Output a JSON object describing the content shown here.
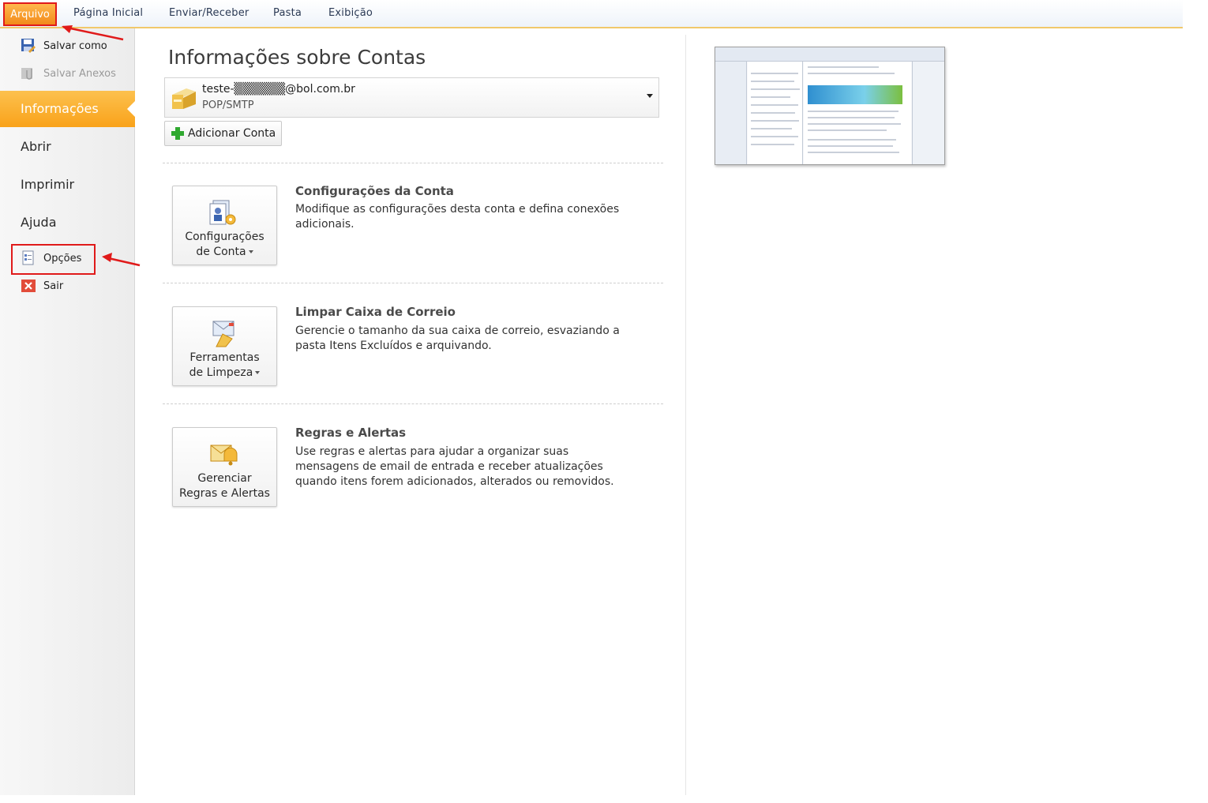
{
  "ribbon": {
    "file_tab": "Arquivo",
    "tabs": [
      "Página Inicial",
      "Enviar/Receber",
      "Pasta",
      "Exibição"
    ]
  },
  "nav": {
    "save_as": "Salvar como",
    "save_attachments": "Salvar Anexos",
    "tabs": [
      "Informações",
      "Abrir",
      "Imprimir",
      "Ajuda"
    ],
    "options": "Opções",
    "exit": "Sair"
  },
  "main": {
    "title": "Informações sobre Contas",
    "account": {
      "email": "teste-▒▒▒▒▒▒@bol.com.br",
      "type": "POP/SMTP"
    },
    "add_account": "Adicionar Conta",
    "sections": [
      {
        "button_line1": "Configurações",
        "button_line2": "de Conta",
        "title": "Configurações da Conta",
        "description": "Modifique as configurações desta conta e defina conexões adicionais."
      },
      {
        "button_line1": "Ferramentas",
        "button_line2": "de Limpeza",
        "title": "Limpar Caixa de Correio",
        "description": "Gerencie o tamanho da sua caixa de correio, esvaziando a pasta Itens Excluídos e arquivando."
      },
      {
        "button_line1": "Gerenciar",
        "button_line2": "Regras e Alertas",
        "title": "Regras e Alertas",
        "description": "Use regras e alertas para ajudar a organizar suas mensagens de email de entrada e receber atualizações quando itens forem adicionados, alterados ou removidos."
      }
    ]
  },
  "colors": {
    "accent_orange": "#f9a21a",
    "annotation_red": "#e01a1a",
    "ribbon_text": "#2b3a55"
  }
}
